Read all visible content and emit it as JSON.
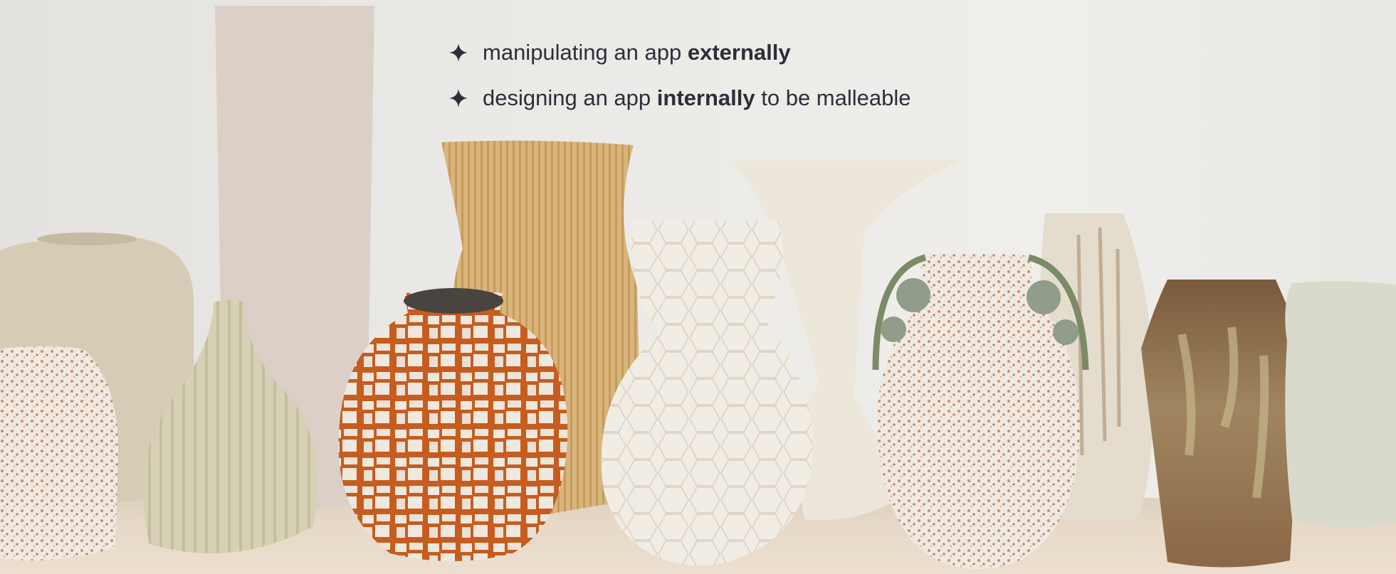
{
  "bullets": [
    {
      "icon": "four-point-star-icon",
      "pre": "manipulating an app ",
      "bold": "externally",
      "post": ""
    },
    {
      "icon": "four-point-star-icon",
      "pre": "designing an app ",
      "bold": "internally",
      "post": " to be malleable"
    }
  ],
  "colors": {
    "text": "#2b2f3a",
    "wall": "#ebeae7",
    "shelf": "#e6d9c8"
  }
}
